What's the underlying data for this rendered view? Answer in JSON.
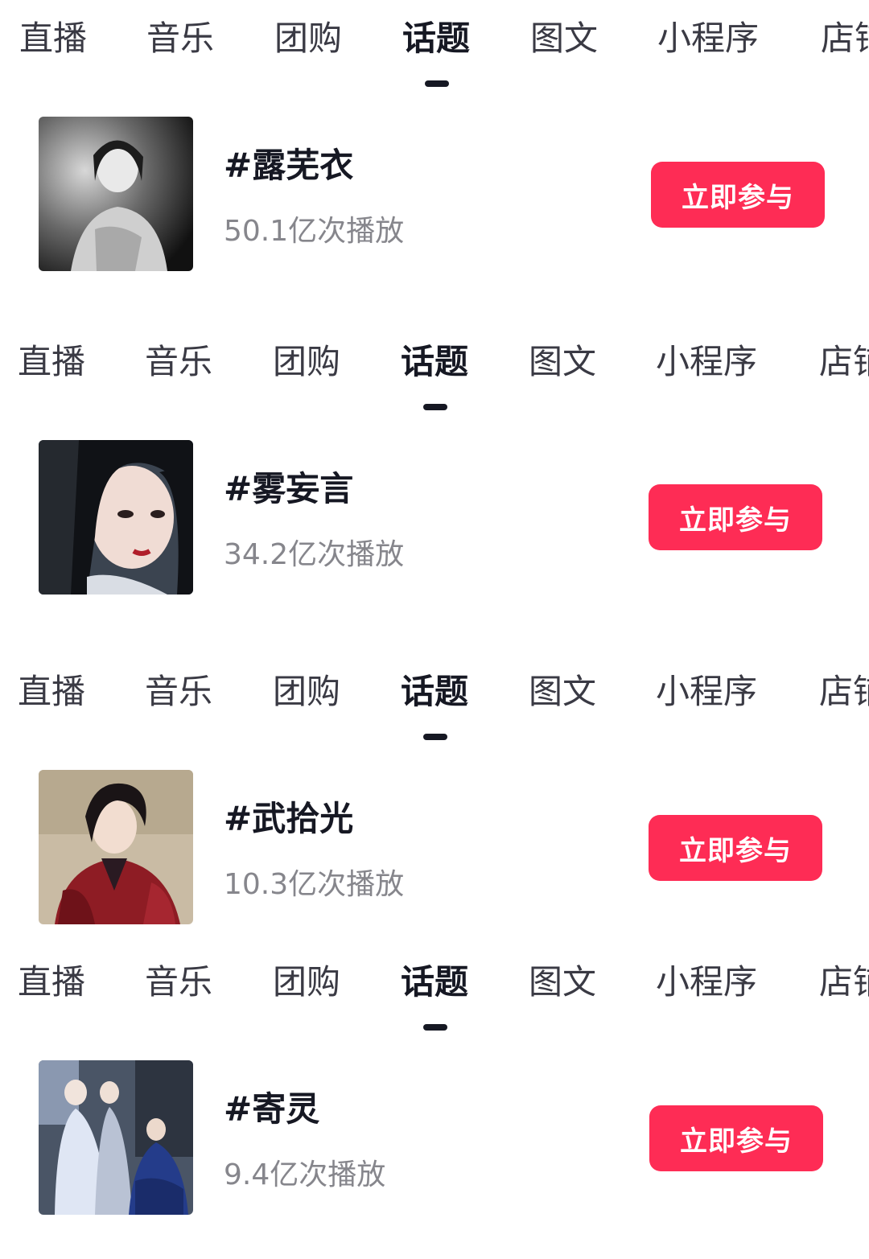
{
  "tabs": [
    "直播",
    "音乐",
    "团购",
    "话题",
    "图文",
    "小程序",
    "店铺"
  ],
  "active_tab_index": 3,
  "accent_color": "#fe2c55",
  "topics": [
    {
      "title": "#露芜衣",
      "play_count": "50.1亿次播放",
      "button_label": "立即参与",
      "thumbnail": "portrait-monochrome-woman"
    },
    {
      "title": "#雾妄言",
      "play_count": "34.2亿次播放",
      "button_label": "立即参与",
      "thumbnail": "portrait-woman-closeup"
    },
    {
      "title": "#武拾光",
      "play_count": "10.3亿次播放",
      "button_label": "立即参与",
      "thumbnail": "portrait-man-red-robe"
    },
    {
      "title": "#寄灵",
      "play_count": "9.4亿次播放",
      "button_label": "立即参与",
      "thumbnail": "scene-group-blue"
    }
  ]
}
